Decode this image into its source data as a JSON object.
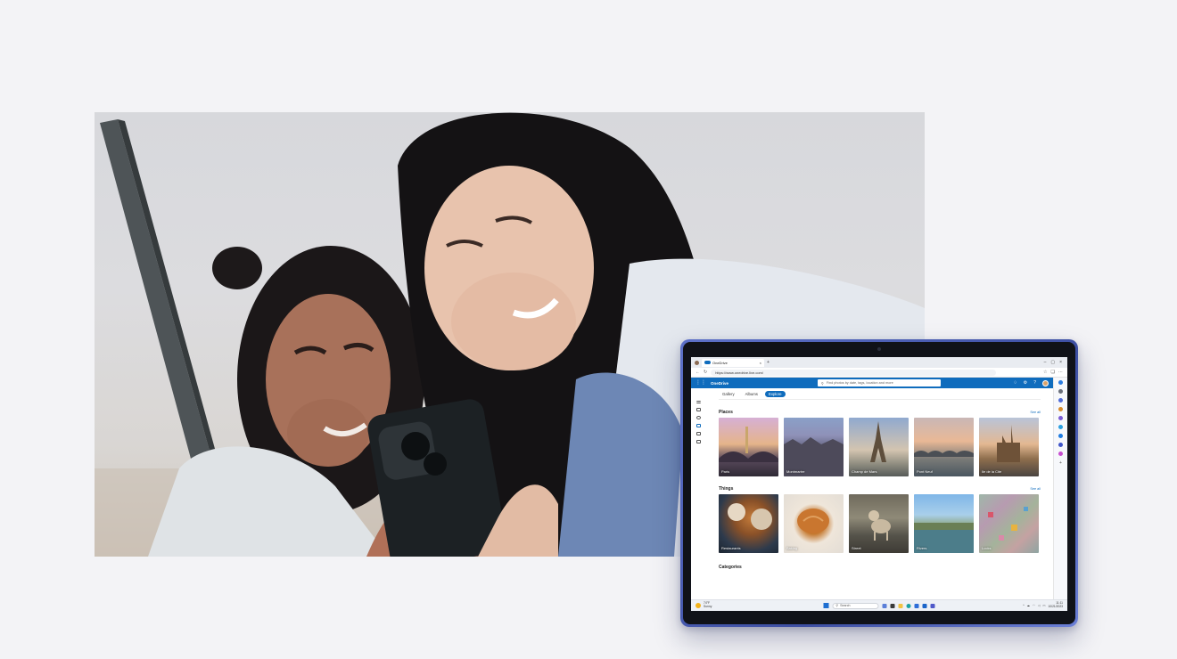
{
  "browser": {
    "tab_title": "OneDrive",
    "url": "https://www.onedrive.live.com/"
  },
  "onedrive": {
    "app_name": "OneDrive",
    "search_placeholder": "Find photos by date, tags, location and more",
    "tabs": [
      "Gallery",
      "Albums",
      "Explore"
    ],
    "active_tab": "Explore",
    "sections": [
      {
        "title": "Places",
        "see_all": "See all",
        "items": [
          "Paris",
          "Montmartre",
          "Champ de Mars",
          "Pont Neuf",
          "Ile de la Cite"
        ]
      },
      {
        "title": "Things",
        "see_all": "See all",
        "items": [
          "Restaurants",
          "Baking",
          "Street",
          "Rivers",
          "Locks"
        ]
      }
    ],
    "categories_title": "Categories"
  },
  "taskbar": {
    "weather_temp": "74°F",
    "weather_desc": "Sunny",
    "search_label": "Search",
    "time": "11:11",
    "date": "10/21/2023"
  },
  "colors": {
    "accent": "#0f6cbd",
    "device_frame": "#4a5cb5",
    "page_background": "#f3f3f6"
  }
}
